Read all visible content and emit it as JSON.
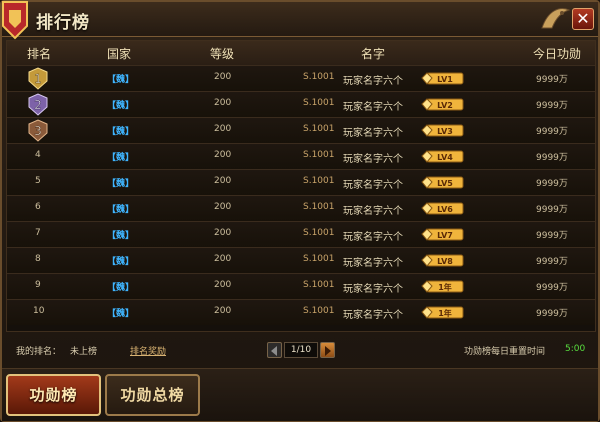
{
  "window": {
    "title": "排行榜",
    "close_glyph": "✕"
  },
  "table": {
    "headers": [
      "排名",
      "国家",
      "等级",
      "名字",
      "今日功勋"
    ],
    "rows": [
      {
        "rank": "1",
        "country": "【魏】",
        "level": "200",
        "server": "S.1001",
        "name": "玩家名字六个",
        "vip": "LV1",
        "merit": "9999万"
      },
      {
        "rank": "2",
        "country": "【魏】",
        "level": "200",
        "server": "S.1001",
        "name": "玩家名字六个",
        "vip": "LV2",
        "merit": "9999万"
      },
      {
        "rank": "3",
        "country": "【魏】",
        "level": "200",
        "server": "S.1001",
        "name": "玩家名字六个",
        "vip": "LV3",
        "merit": "9999万"
      },
      {
        "rank": "4",
        "country": "【魏】",
        "level": "200",
        "server": "S.1001",
        "name": "玩家名字六个",
        "vip": "LV4",
        "merit": "9999万"
      },
      {
        "rank": "5",
        "country": "【魏】",
        "level": "200",
        "server": "S.1001",
        "name": "玩家名字六个",
        "vip": "LV5",
        "merit": "9999万"
      },
      {
        "rank": "6",
        "country": "【魏】",
        "level": "200",
        "server": "S.1001",
        "name": "玩家名字六个",
        "vip": "LV6",
        "merit": "9999万"
      },
      {
        "rank": "7",
        "country": "【魏】",
        "level": "200",
        "server": "S.1001",
        "name": "玩家名字六个",
        "vip": "LV7",
        "merit": "9999万"
      },
      {
        "rank": "8",
        "country": "【魏】",
        "level": "200",
        "server": "S.1001",
        "name": "玩家名字六个",
        "vip": "LV8",
        "merit": "9999万"
      },
      {
        "rank": "9",
        "country": "【魏】",
        "level": "200",
        "server": "S.1001",
        "name": "玩家名字六个",
        "vip": "1年",
        "merit": "9999万"
      },
      {
        "rank": "10",
        "country": "【魏】",
        "level": "200",
        "server": "S.1001",
        "name": "玩家名字六个",
        "vip": "1年",
        "merit": "9999万"
      }
    ]
  },
  "footer": {
    "my_rank_label": "我的排名：",
    "my_rank_value": "未上榜",
    "reward_link": "排名奖励",
    "page": "1/10",
    "reset_label": "功勋榜每日重置时间",
    "reset_time": "5:00"
  },
  "tabs": [
    {
      "label": "功勋榜",
      "active": true
    },
    {
      "label": "功勋总榜",
      "active": false
    }
  ],
  "icons": {
    "title_emblem": "golden-crest-icon",
    "title_ornament": "dragon-ornament-icon",
    "close": "close-icon",
    "rank_badges": [
      "gold-medal-icon",
      "silver-medal-icon",
      "bronze-medal-icon"
    ],
    "vip_badge": "diamond-vip-icon",
    "page_prev": "arrow-left-icon",
    "page_next": "arrow-right-icon"
  },
  "colors": {
    "country": "#3fb5ff",
    "reset_time": "#58dc3f",
    "active_tab": "#a33a1a",
    "vip_badge": "#f0b43c"
  }
}
